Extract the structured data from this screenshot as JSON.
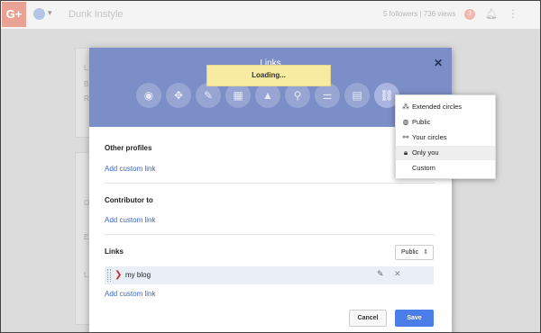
{
  "topbar": {
    "logo": "G+",
    "brand": "Dunk Instyle",
    "stats": "5 followers | 736 views",
    "notification_count": "3"
  },
  "dialog": {
    "title": "Links",
    "loading_text": "Loading...",
    "categories": [
      {
        "icon": "story-icon"
      },
      {
        "icon": "people-icon"
      },
      {
        "icon": "pencil-icon"
      },
      {
        "icon": "work-icon"
      },
      {
        "icon": "education-icon"
      },
      {
        "icon": "places-icon"
      },
      {
        "icon": "basic-info-icon"
      },
      {
        "icon": "contact-icon"
      },
      {
        "icon": "links-icon",
        "active": true
      }
    ],
    "sections": {
      "other_profiles": {
        "title": "Other profiles",
        "add": "Add custom link"
      },
      "contributor_to": {
        "title": "Contributor to",
        "add": "Add custom link"
      },
      "links": {
        "title": "Links",
        "add": "Add custom link",
        "visibility": "Public"
      }
    },
    "link_items": [
      {
        "label": "my blog"
      }
    ],
    "buttons": {
      "cancel": "Cancel",
      "save": "Save"
    }
  },
  "visibility_menu": {
    "items": [
      {
        "label": "Extended circles",
        "icon": "extended-circles-icon",
        "selected": false
      },
      {
        "label": "Public",
        "icon": "globe-icon",
        "selected": false
      },
      {
        "label": "Your circles",
        "icon": "circles-icon",
        "selected": false
      },
      {
        "label": "Only you",
        "icon": "lock-icon",
        "selected": true
      },
      {
        "label": "Custom",
        "icon": "",
        "selected": false
      }
    ]
  },
  "colors": {
    "header": "#7b8ec7",
    "save": "#4b7de8",
    "link": "#3c68c8",
    "loading_bg": "#f7eaa1"
  }
}
